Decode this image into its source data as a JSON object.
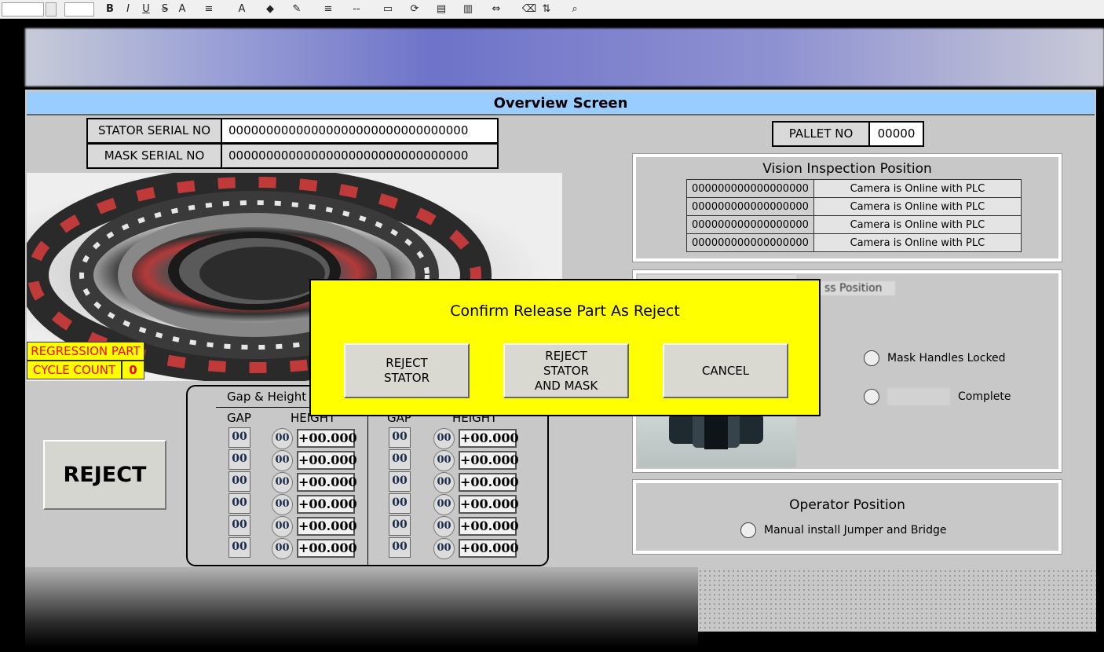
{
  "screen": {
    "title": "Overview Screen"
  },
  "serials": {
    "stator_label": "STATOR SERIAL NO",
    "stator_value": "00000000000000000000000000000000",
    "mask_label": "MASK SERIAL NO",
    "mask_value": "00000000000000000000000000000000"
  },
  "pallet": {
    "label": "PALLET NO",
    "value": "00000"
  },
  "vision": {
    "title": "Vision Inspection Position",
    "rows": [
      {
        "id": "000000000000000000",
        "status": "Camera is Online with PLC"
      },
      {
        "id": "000000000000000000",
        "status": "Camera is Online with PLC"
      },
      {
        "id": "000000000000000000",
        "status": "Camera is Online with PLC"
      },
      {
        "id": "000000000000000000",
        "status": "Camera is Online with PLC"
      }
    ]
  },
  "mask_section": {
    "title_fragment": "ss Position",
    "items": [
      "Mask Handles Locked",
      "Complete"
    ]
  },
  "operator": {
    "title": "Operator Position",
    "items": [
      "Manual install Jumper and Bridge"
    ]
  },
  "regression": {
    "label": "REGRESSION PART",
    "cycle_label": "CYCLE COUNT",
    "cycle_value": "0"
  },
  "reject_button": "REJECT",
  "gap_panel": {
    "title": "Gap & Height C",
    "gap_header": "GAP",
    "height_header": "HEIGHT",
    "left_rows": [
      {
        "gap": "00",
        "circ": "00",
        "height": "+00.000"
      },
      {
        "gap": "00",
        "circ": "00",
        "height": "+00.000"
      },
      {
        "gap": "00",
        "circ": "00",
        "height": "+00.000"
      },
      {
        "gap": "00",
        "circ": "00",
        "height": "+00.000"
      },
      {
        "gap": "00",
        "circ": "00",
        "height": "+00.000"
      },
      {
        "gap": "00",
        "circ": "00",
        "height": "+00.000"
      }
    ],
    "right_rows": [
      {
        "gap": "00",
        "circ": "00",
        "height": "+00.000"
      },
      {
        "gap": "00",
        "circ": "00",
        "height": "+00.000"
      },
      {
        "gap": "00",
        "circ": "00",
        "height": "+00.000"
      },
      {
        "gap": "00",
        "circ": "00",
        "height": "+00.000"
      },
      {
        "gap": "00",
        "circ": "00",
        "height": "+00.000"
      },
      {
        "gap": "00",
        "circ": "00",
        "height": "+00.000"
      }
    ]
  },
  "dialog": {
    "title": "Confirm Release Part As Reject",
    "buttons": [
      "REJECT\nSTATOR",
      "REJECT\nSTATOR\nAND MASK",
      "CANCEL"
    ]
  },
  "toolbar": {
    "icons": [
      "bold-icon",
      "italic-icon",
      "underline-icon",
      "strikethrough-icon",
      "font-size-icon",
      "align-icon",
      "font-color-icon",
      "fill-color-icon",
      "line-color-icon",
      "line-style-icon",
      "dash-style-icon",
      "arrange-icon",
      "rotate-icon",
      "align-objects-icon",
      "distribute-icon",
      "spacing-icon",
      "eraser-icon",
      "order-icon",
      "zoom-icon"
    ],
    "glyphs": [
      "B",
      "I",
      "U",
      "S",
      "A",
      "≡",
      "A",
      "◆",
      "✎",
      "≡",
      "--",
      "▭",
      "⟳",
      "▤",
      "▥",
      "⇔",
      "⌫",
      "⇅",
      "⌕"
    ]
  },
  "colors": {
    "title_bar": "#99ccff",
    "dialog": "#ffff00",
    "screen_bg": "#c8c8c8",
    "regression_text": "#ff0000"
  }
}
